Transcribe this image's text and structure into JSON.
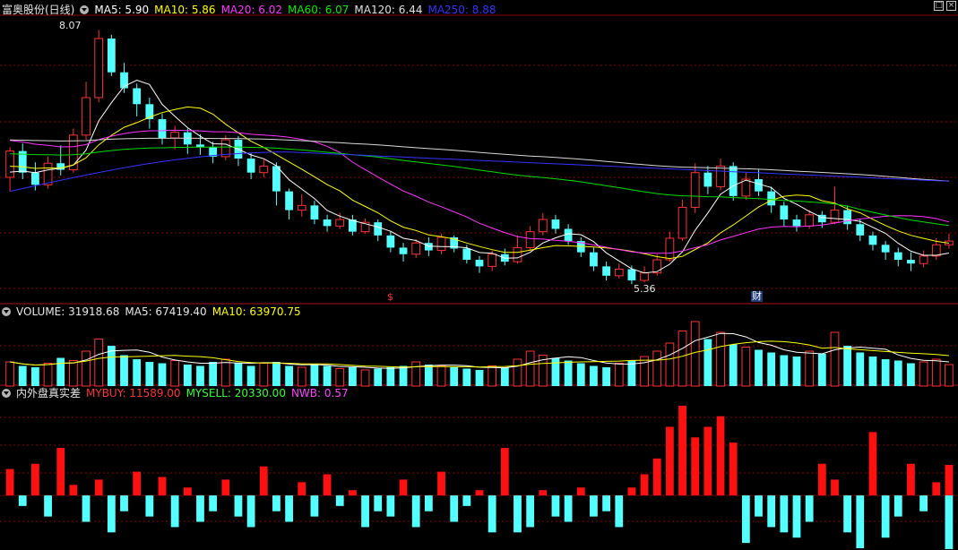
{
  "header": {
    "stock_name": "富奥股份(日线)",
    "ma5": "MA5: 5.90",
    "ma10": "MA10: 5.86",
    "ma20": "MA20: 6.02",
    "ma60": "MA60: 6.07",
    "ma120": "MA120: 6.44",
    "ma250": "MA250: 8.88"
  },
  "price_panel": {
    "high_label": "8.07",
    "low_label": "5.36",
    "marker_s": "$",
    "marker_fin": "财"
  },
  "volume_panel": {
    "title": "VOLUME: 31918.68",
    "ma5": "MA5: 67419.40",
    "ma10": "MA10: 63970.75"
  },
  "flow_panel": {
    "title": "内外盘真实差",
    "mybuy": "MYBUY: 11589.00",
    "mysell": "MYSELL: 20330.00",
    "nwb": "NWB: 0.57"
  },
  "window_controls": {
    "restore": "□",
    "close": "×"
  },
  "colors": {
    "up": "#ff3232",
    "down": "#54ffff",
    "ma5": "#ffffff",
    "ma10": "#ffff00",
    "ma20": "#ff33ff",
    "ma60": "#00dd00",
    "ma120": "#d8d8d8",
    "ma250": "#3333ff",
    "grid": "#8a0000"
  },
  "chart_data": {
    "type": "candlestick",
    "price_range": [
      5.2,
      8.2
    ],
    "candles": [
      [
        6.5,
        6.78,
        6.82,
        6.35
      ],
      [
        6.78,
        6.55,
        6.86,
        6.48
      ],
      [
        6.55,
        6.42,
        6.66,
        6.36
      ],
      [
        6.42,
        6.65,
        6.72,
        6.38
      ],
      [
        6.65,
        6.58,
        6.84,
        6.52
      ],
      [
        6.58,
        6.95,
        7.02,
        6.55
      ],
      [
        6.95,
        7.35,
        7.52,
        6.9
      ],
      [
        7.35,
        7.98,
        8.07,
        7.3
      ],
      [
        7.98,
        7.62,
        8.02,
        7.58
      ],
      [
        7.62,
        7.45,
        7.72,
        7.4
      ],
      [
        7.45,
        7.28,
        7.5,
        7.15
      ],
      [
        7.28,
        7.12,
        7.35,
        7.02
      ],
      [
        7.12,
        6.92,
        7.18,
        6.85
      ],
      [
        6.92,
        6.98,
        7.05,
        6.8
      ],
      [
        6.98,
        6.85,
        7.02,
        6.75
      ],
      [
        6.85,
        6.82,
        6.96,
        6.74
      ],
      [
        6.82,
        6.72,
        6.88,
        6.65
      ],
      [
        6.72,
        6.9,
        6.95,
        6.68
      ],
      [
        6.9,
        6.7,
        6.94,
        6.62
      ],
      [
        6.7,
        6.55,
        6.76,
        6.48
      ],
      [
        6.55,
        6.62,
        6.7,
        6.5
      ],
      [
        6.62,
        6.35,
        6.66,
        6.2
      ],
      [
        6.35,
        6.15,
        6.38,
        6.05
      ],
      [
        6.15,
        6.2,
        6.32,
        6.08
      ],
      [
        6.2,
        6.05,
        6.25,
        6.0
      ],
      [
        6.05,
        5.98,
        6.1,
        5.92
      ],
      [
        5.98,
        6.05,
        6.12,
        5.95
      ],
      [
        6.05,
        5.92,
        6.1,
        5.88
      ],
      [
        5.92,
        6.02,
        6.06,
        5.9
      ],
      [
        6.02,
        5.88,
        6.05,
        5.82
      ],
      [
        5.88,
        5.75,
        5.92,
        5.7
      ],
      [
        5.75,
        5.68,
        5.8,
        5.6
      ],
      [
        5.68,
        5.8,
        5.84,
        5.64
      ],
      [
        5.8,
        5.72,
        5.86,
        5.66
      ],
      [
        5.72,
        5.86,
        5.9,
        5.68
      ],
      [
        5.86,
        5.74,
        5.88,
        5.7
      ],
      [
        5.74,
        5.62,
        5.78,
        5.58
      ],
      [
        5.62,
        5.55,
        5.66,
        5.48
      ],
      [
        5.55,
        5.68,
        5.72,
        5.5
      ],
      [
        5.68,
        5.6,
        5.74,
        5.56
      ],
      [
        5.6,
        5.75,
        5.88,
        5.58
      ],
      [
        5.75,
        5.92,
        5.98,
        5.72
      ],
      [
        5.92,
        6.05,
        6.12,
        5.88
      ],
      [
        6.05,
        5.95,
        6.1,
        5.9
      ],
      [
        5.95,
        5.82,
        6.0,
        5.78
      ],
      [
        5.82,
        5.7,
        5.86,
        5.65
      ],
      [
        5.7,
        5.55,
        5.75,
        5.5
      ],
      [
        5.55,
        5.45,
        5.6,
        5.4
      ],
      [
        5.45,
        5.52,
        5.58,
        5.42
      ],
      [
        5.52,
        5.4,
        5.56,
        5.36
      ],
      [
        5.4,
        5.48,
        5.55,
        5.38
      ],
      [
        5.48,
        5.62,
        5.68,
        5.45
      ],
      [
        5.62,
        5.85,
        5.92,
        5.6
      ],
      [
        5.85,
        6.18,
        6.26,
        5.82
      ],
      [
        6.18,
        6.55,
        6.65,
        6.12
      ],
      [
        6.55,
        6.4,
        6.62,
        6.32
      ],
      [
        6.4,
        6.62,
        6.7,
        6.36
      ],
      [
        6.62,
        6.3,
        6.66,
        6.25
      ],
      [
        6.3,
        6.48,
        6.55,
        6.26
      ],
      [
        6.48,
        6.35,
        6.58,
        6.3
      ],
      [
        6.35,
        6.2,
        6.4,
        6.12
      ],
      [
        6.2,
        6.05,
        6.24,
        5.98
      ],
      [
        6.05,
        5.98,
        6.1,
        5.92
      ],
      [
        5.98,
        6.1,
        6.15,
        5.95
      ],
      [
        6.1,
        6.02,
        6.14,
        5.96
      ],
      [
        6.02,
        6.15,
        6.4,
        6.0
      ],
      [
        6.15,
        6.0,
        6.2,
        5.94
      ],
      [
        6.0,
        5.88,
        6.05,
        5.82
      ],
      [
        5.88,
        5.78,
        5.92,
        5.72
      ],
      [
        5.78,
        5.7,
        5.82,
        5.62
      ],
      [
        5.7,
        5.62,
        5.75,
        5.55
      ],
      [
        5.62,
        5.58,
        5.7,
        5.5
      ],
      [
        5.58,
        5.66,
        5.72,
        5.54
      ],
      [
        5.66,
        5.78,
        5.85,
        5.62
      ],
      [
        5.78,
        5.82,
        5.9,
        5.74
      ]
    ],
    "volume_range": [
      0,
      100000
    ],
    "volume": [
      36000,
      30000,
      28000,
      34000,
      42000,
      38000,
      52000,
      70000,
      60000,
      46000,
      40000,
      36000,
      34000,
      38000,
      32000,
      30000,
      36000,
      40000,
      34000,
      30000,
      34000,
      36000,
      30000,
      28000,
      32000,
      30000,
      26000,
      28000,
      24000,
      26000,
      28000,
      30000,
      36000,
      32000,
      30000,
      28000,
      26000,
      24000,
      30000,
      28000,
      40000,
      52000,
      46000,
      42000,
      38000,
      34000,
      30000,
      28000,
      34000,
      38000,
      44000,
      52000,
      64000,
      82000,
      96000,
      70000,
      80000,
      62000,
      58000,
      54000,
      50000,
      46000,
      44000,
      52000,
      48000,
      80000,
      60000,
      50000,
      44000,
      40000,
      38000,
      34000,
      36000,
      40000,
      31918.68
    ],
    "flow_range": [
      -20000,
      36000
    ],
    "mybuy": [
      10000,
      0,
      12000,
      0,
      18000,
      4000,
      0,
      6000,
      0,
      0,
      9000,
      0,
      7000,
      0,
      3000,
      0,
      0,
      6000,
      0,
      0,
      11000,
      0,
      0,
      5000,
      0,
      8000,
      0,
      2000,
      0,
      0,
      0,
      6000,
      0,
      0,
      9000,
      0,
      0,
      2000,
      0,
      18000,
      0,
      0,
      2000,
      0,
      0,
      3000,
      0,
      0,
      0,
      3000,
      8000,
      14000,
      26000,
      34000,
      22000,
      26000,
      30000,
      20000,
      0,
      0,
      0,
      0,
      0,
      0,
      12000,
      6000,
      0,
      0,
      24000,
      0,
      0,
      12000,
      0,
      5000,
      11589
    ],
    "mysell": [
      0,
      4000,
      0,
      8000,
      0,
      0,
      10000,
      0,
      14000,
      6000,
      0,
      8000,
      0,
      12000,
      0,
      10000,
      6000,
      0,
      8000,
      12000,
      0,
      6000,
      10000,
      0,
      8000,
      0,
      4000,
      0,
      12000,
      6000,
      8000,
      0,
      12000,
      6000,
      0,
      10000,
      4000,
      0,
      14000,
      0,
      14000,
      12000,
      0,
      8000,
      10000,
      0,
      8000,
      6000,
      12000,
      0,
      0,
      0,
      0,
      0,
      0,
      0,
      0,
      0,
      18000,
      8000,
      12000,
      14000,
      16000,
      10000,
      0,
      0,
      14000,
      20000,
      0,
      16000,
      8000,
      0,
      6000,
      0,
      20330
    ]
  }
}
